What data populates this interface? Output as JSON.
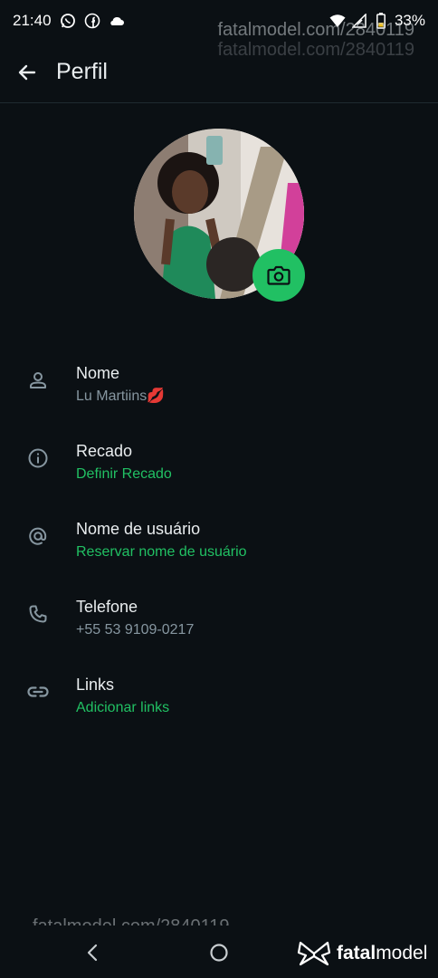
{
  "status": {
    "time": "21:40",
    "battery": "33%"
  },
  "watermark": {
    "top": "fatalmodel.com/2840119",
    "bottom": "fatalmodel.com/2840119",
    "brand_bold": "fatal",
    "brand_rest": "model"
  },
  "header": {
    "title": "Perfil"
  },
  "rows": [
    {
      "label": "Nome",
      "value": "Lu Martiins💋"
    },
    {
      "label": "Recado",
      "value": "Definir Recado"
    },
    {
      "label": "Nome de usuário",
      "value": "Reservar nome de usuário"
    },
    {
      "label": "Telefone",
      "value": "+55 53 9109-0217"
    },
    {
      "label": "Links",
      "value": "Adicionar links"
    }
  ],
  "colors": {
    "background": "#0b1014",
    "accent": "#21c063",
    "secondary_text": "#8696a0"
  },
  "icons": {
    "status": [
      "whatsapp-icon",
      "facebook-icon",
      "cloud-icon",
      "wifi-icon",
      "signal-icon",
      "battery-icon"
    ],
    "rows": [
      "person-icon",
      "info-icon",
      "at-icon",
      "phone-icon",
      "link-icon"
    ]
  }
}
